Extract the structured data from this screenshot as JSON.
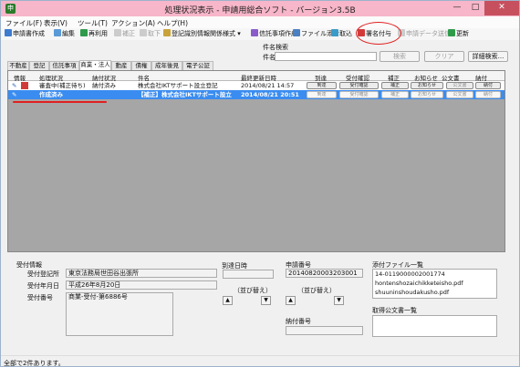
{
  "window": {
    "title": "処理状況表示 - 申請用総合ソフト - バージョン3.5B",
    "min": "—",
    "max": "□",
    "close": "✕"
  },
  "menu": [
    "ファイル(F)",
    "表示(V)",
    "ツール(T)",
    "アクション(A)",
    "ヘルプ(H)"
  ],
  "toolbar": [
    {
      "label": "申請書作成",
      "icon": "document-icon",
      "enabled": true
    },
    {
      "label": "編集",
      "icon": "edit-icon",
      "enabled": true
    },
    {
      "label": "再利用",
      "icon": "reuse-icon",
      "enabled": true
    },
    {
      "label": "補正",
      "icon": "correct-icon",
      "enabled": false
    },
    {
      "label": "取下",
      "icon": "withdraw-icon",
      "enabled": false
    },
    {
      "label": "登記識別情報関係様式 ▾",
      "icon": "form-icon",
      "enabled": true
    },
    {
      "label": "信託事項作成",
      "icon": "trust-icon",
      "enabled": true
    },
    {
      "label": "ファイル添付",
      "icon": "attach-icon",
      "enabled": true
    },
    {
      "label": "取込",
      "icon": "import-icon",
      "enabled": true
    },
    {
      "label": "署名付与",
      "icon": "signature-icon",
      "enabled": true
    },
    {
      "label": "申請データ送信",
      "icon": "send-icon",
      "enabled": false
    },
    {
      "label": "更新",
      "icon": "refresh-icon",
      "enabled": true
    }
  ],
  "search": {
    "label": "件名検索",
    "field_label": "件名",
    "search_btn": "検索",
    "clear_btn": "クリア",
    "detail_btn": "詳細検索..."
  },
  "tabs": [
    "不動産",
    "登記",
    "信託事項",
    "商業・法人",
    "動産",
    "債権",
    "成年後見",
    "電子公証"
  ],
  "active_tab": "商業・法人",
  "grid": {
    "columns": [
      "情報",
      "処理状況",
      "納付状況",
      "件名",
      "最終更新日時",
      "到達",
      "受付確認",
      "補正",
      "お知らせ",
      "公文書",
      "納付"
    ],
    "row_buttons": [
      "到達",
      "受付確認",
      "補正",
      "お知らせ",
      "公文書",
      "納付"
    ],
    "rows": [
      {
        "status": "審査中(補正待ち)",
        "payment": "納付済み",
        "subject": "株式会社IKTサポート設立登記",
        "updated": "2014/08/21 14:57"
      },
      {
        "status": "作成済み",
        "payment": "",
        "subject": "【補正】株式会社IKTサポート設立",
        "updated": "2014/08/21 20:51"
      }
    ]
  },
  "detail": {
    "receipt_title": "受付情報",
    "office_label": "受付登記所",
    "office_value": "東京法務局世田谷出張所",
    "date_label": "受付年月日",
    "date_value": "平成26年8月20日",
    "number_label": "受付番号",
    "number_value": "商業-受付-第6886号",
    "arrival_label": "到達日時",
    "sort_label": "（並び替え）",
    "app_no_label": "申請番号",
    "app_no_value": "20140820003203001",
    "pay_no_label": "納付番号",
    "attach_label": "添付ファイル一覧",
    "attach_items": [
      "14-0119000002001774",
      "hontenshozaichikketeisho.pdf",
      "shuuninshoudakusho.pdf"
    ],
    "docs_label": "取得公文書一覧"
  },
  "status": "全部で2件あります。"
}
